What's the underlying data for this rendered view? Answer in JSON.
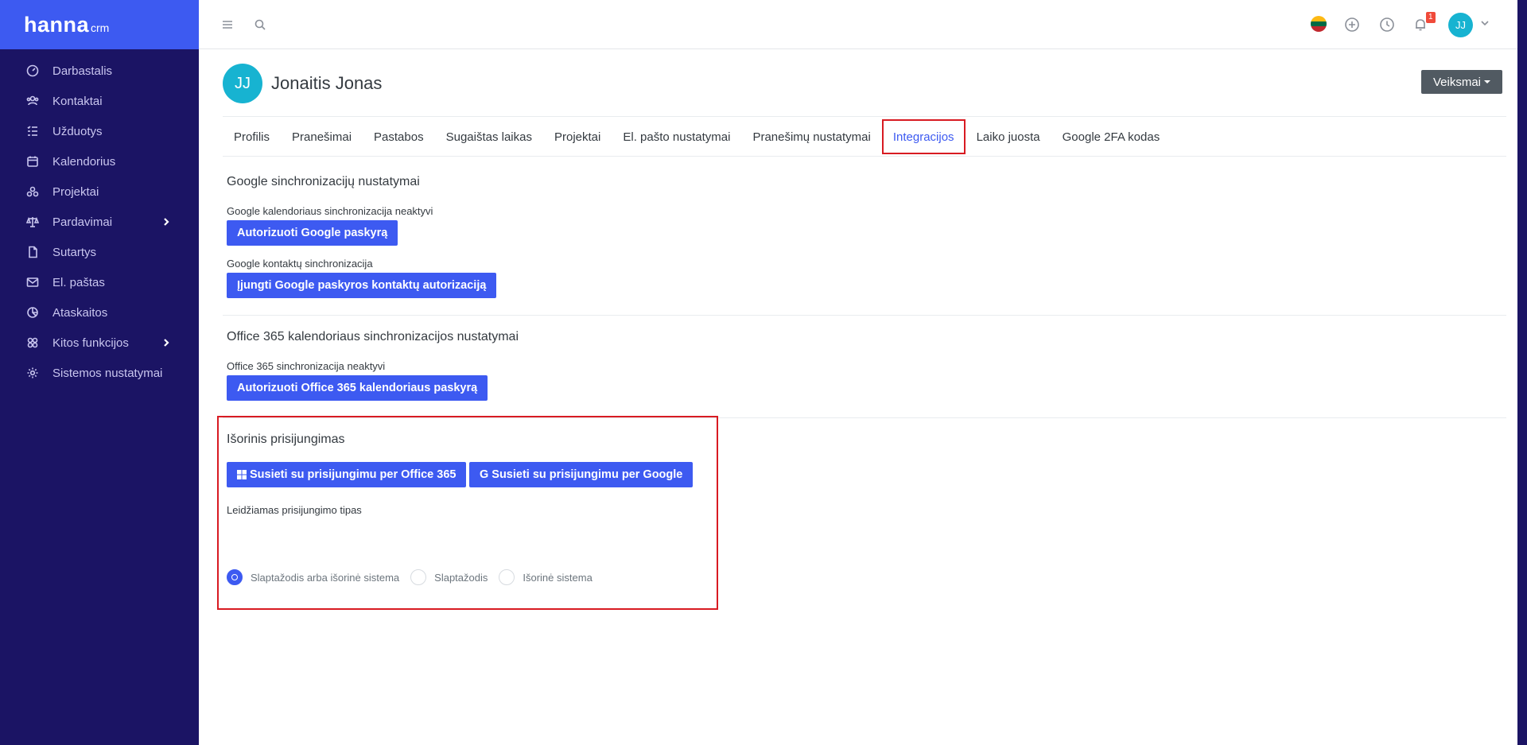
{
  "brand": {
    "name": "hanna",
    "suffix": "crm"
  },
  "sidebar": {
    "items": [
      {
        "label": "Darbastalis",
        "icon": "dashboard-icon"
      },
      {
        "label": "Kontaktai",
        "icon": "users-icon"
      },
      {
        "label": "Užduotys",
        "icon": "tasks-icon"
      },
      {
        "label": "Kalendorius",
        "icon": "calendar-icon"
      },
      {
        "label": "Projektai",
        "icon": "projects-icon"
      },
      {
        "label": "Pardavimai",
        "icon": "scale-icon",
        "expandable": true
      },
      {
        "label": "Sutartys",
        "icon": "file-icon"
      },
      {
        "label": "El. paštas",
        "icon": "mail-icon"
      },
      {
        "label": "Ataskaitos",
        "icon": "reports-icon"
      },
      {
        "label": "Kitos funkcijos",
        "icon": "functions-icon",
        "expandable": true
      },
      {
        "label": "Sistemos nustatymai",
        "icon": "gear-icon"
      }
    ]
  },
  "topbar": {
    "notifications_count": "1",
    "user_initials": "JJ",
    "language_flag": "lt"
  },
  "profile": {
    "initials": "JJ",
    "name": "Jonaitis Jonas",
    "actions_label": "Veiksmai"
  },
  "tabs": [
    {
      "label": "Profilis"
    },
    {
      "label": "Pranešimai"
    },
    {
      "label": "Pastabos"
    },
    {
      "label": "Sugaištas laikas"
    },
    {
      "label": "Projektai"
    },
    {
      "label": "El. pašto nustatymai"
    },
    {
      "label": "Pranešimų nustatymai"
    },
    {
      "label": "Integracijos",
      "active": true
    },
    {
      "label": "Laiko juosta"
    },
    {
      "label": "Google 2FA kodas"
    }
  ],
  "google_sync": {
    "title": "Google sinchronizacijų nustatymai",
    "calendar_status": "Google kalendoriaus sinchronizacija neaktyvi",
    "authorize_button": "Autorizuoti Google paskyrą",
    "contacts_label": "Google kontaktų sinchronizacija",
    "contacts_button": "Įjungti Google paskyros kontaktų autorizaciją"
  },
  "office_sync": {
    "title": "Office 365 kalendoriaus sinchronizacijos nustatymai",
    "status": "Office 365 sinchronizacija neaktyvi",
    "authorize_button": "Autorizuoti Office 365 kalendoriaus paskyrą"
  },
  "external_login": {
    "title": "Išorinis prisijungimas",
    "office_button": "Susieti su prisijungimu per Office 365",
    "google_button": "Susieti su prisijungimu per Google",
    "login_type_label": "Leidžiamas prisijungimo tipas",
    "options": [
      {
        "label": "Slaptažodis arba išorinė sistema",
        "checked": true
      },
      {
        "label": "Slaptažodis",
        "checked": false
      },
      {
        "label": "Išorinė sistema",
        "checked": false
      }
    ]
  },
  "colors": {
    "sidebar_bg": "#1b1464",
    "brand_bg": "#3d5af1",
    "primary": "#3d5af1",
    "highlight": "#d81b22",
    "avatar": "#17b3d1"
  }
}
